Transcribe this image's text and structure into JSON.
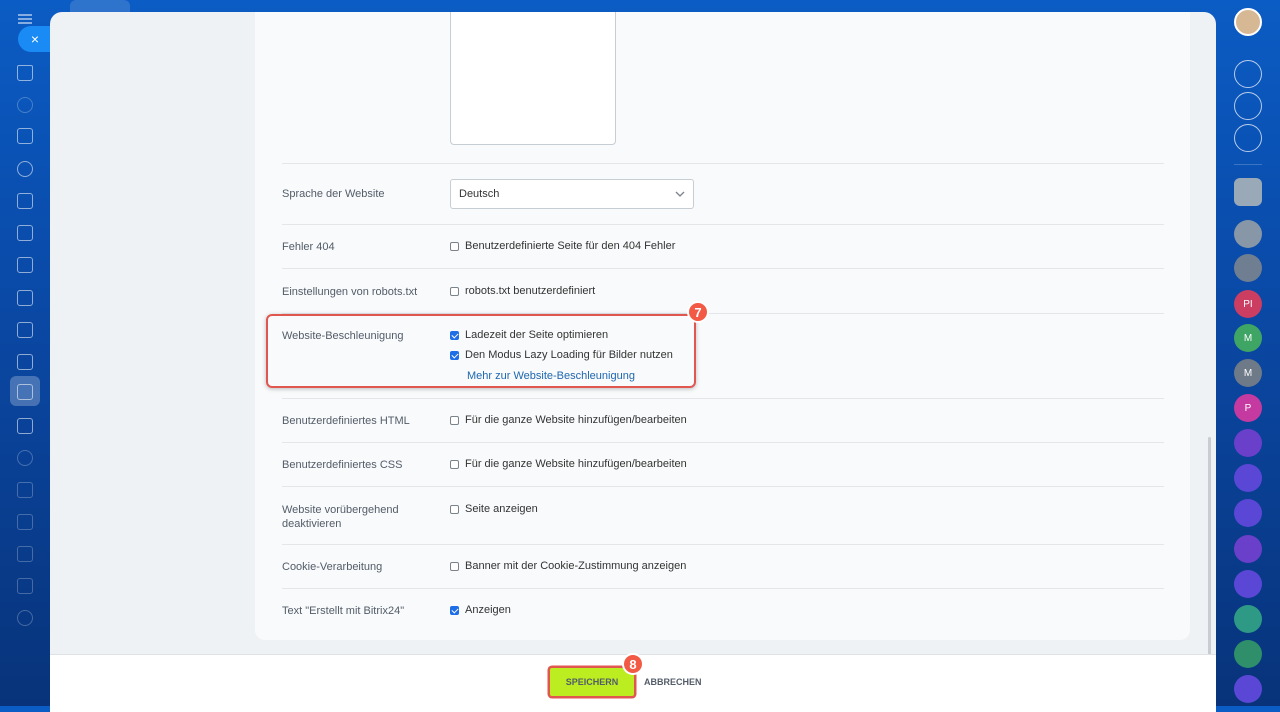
{
  "settings": {
    "language": {
      "label": "Sprache der Website",
      "value": "Deutsch"
    },
    "error404": {
      "label": "Fehler 404",
      "option": "Benutzerdefinierte Seite für den 404 Fehler"
    },
    "robots": {
      "label": "Einstellungen von robots.txt",
      "option": "robots.txt benutzerdefiniert"
    },
    "speed": {
      "label": "Website-Beschleunigung",
      "option1": "Ladezeit der Seite optimieren",
      "option2": "Den Modus Lazy Loading für Bilder nutzen",
      "link": "Mehr zur Website-Beschleunigung"
    },
    "html": {
      "label": "Benutzerdefiniertes HTML",
      "option": "Für die ganze Website hinzufügen/bearbeiten"
    },
    "css": {
      "label": "Benutzerdefiniertes CSS",
      "option": "Für die ganze Website hinzufügen/bearbeiten"
    },
    "deactivate": {
      "label": "Website vorübergehend deaktivieren",
      "option": "Seite anzeigen"
    },
    "cookie": {
      "label": "Cookie-Verarbeitung",
      "option": "Banner mit der Cookie-Zustimmung anzeigen"
    },
    "bitrix": {
      "label": "Text \"Erstellt mit Bitrix24\"",
      "option": "Anzeigen"
    }
  },
  "annotations": {
    "badge7": "7",
    "badge8": "8"
  },
  "footer": {
    "save": "SPEICHERN",
    "cancel": "ABBRECHEN"
  },
  "right_rail": {
    "pi": "PI",
    "m1": "M",
    "m2": "M",
    "p": "P"
  },
  "icons": {
    "close": "×"
  }
}
